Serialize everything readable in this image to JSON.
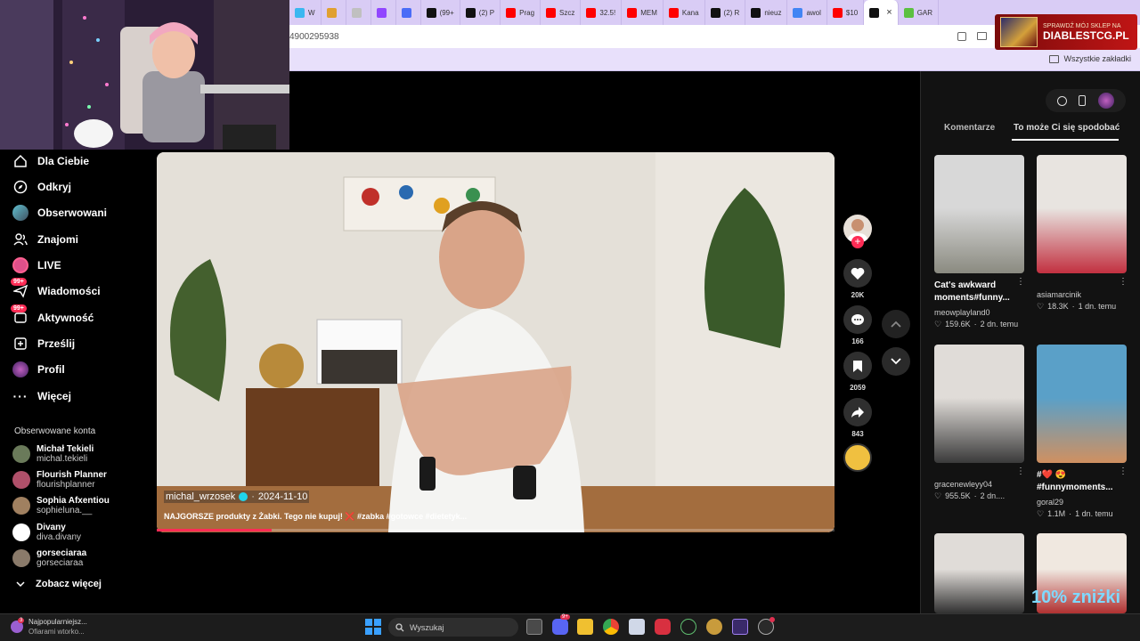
{
  "browser": {
    "tabs": [
      {
        "label": "W",
        "color": "#3ab7f0"
      },
      {
        "label": "",
        "color": "#e0a030"
      },
      {
        "label": "",
        "color": "#c0c0c0"
      },
      {
        "label": "",
        "color": "#9146ff"
      },
      {
        "label": "",
        "color": "#4a6cf7"
      },
      {
        "label": "(99+",
        "color": "#111111"
      },
      {
        "label": "(2) P",
        "color": "#111111"
      },
      {
        "label": "Prag",
        "color": "#ff0000"
      },
      {
        "label": "Szcz",
        "color": "#ff0000"
      },
      {
        "label": "32.5!",
        "color": "#ff0000"
      },
      {
        "label": "MEM",
        "color": "#ff0000"
      },
      {
        "label": "Kana",
        "color": "#ff0000"
      },
      {
        "label": "(2) R",
        "color": "#111111"
      },
      {
        "label": "nieuz",
        "color": "#111111"
      },
      {
        "label": "awol",
        "color": "#4285f4"
      },
      {
        "label": "$10",
        "color": "#ff0000"
      },
      {
        "label": "",
        "color": "#111111"
      },
      {
        "label": "GAR",
        "color": "#5cc040"
      }
    ],
    "address": "4900295938",
    "bookmarks_all": "Wszystkie zakładki"
  },
  "ad": {
    "line1": "SPRAWDŹ MÓJ SKLEP NA",
    "line2": "DIABLESTCG.PL"
  },
  "sidebar": {
    "items": [
      {
        "label": "Dla Ciebie",
        "icon": "home-icon"
      },
      {
        "label": "Odkryj",
        "icon": "compass-icon"
      },
      {
        "label": "Obserwowani",
        "icon": "following-icon"
      },
      {
        "label": "Znajomi",
        "icon": "friends-icon"
      },
      {
        "label": "LIVE",
        "icon": "live-icon"
      },
      {
        "label": "Wiadomości",
        "icon": "messages-icon",
        "badge": "99+"
      },
      {
        "label": "Aktywność",
        "icon": "activity-icon",
        "badge": "99+"
      },
      {
        "label": "Prześlij",
        "icon": "upload-icon"
      },
      {
        "label": "Profil",
        "icon": "profile-icon"
      },
      {
        "label": "Więcej",
        "icon": "more-icon"
      }
    ],
    "following_title": "Obserwowane konta",
    "accounts": [
      {
        "name": "Michał Tekieli",
        "handle": "michal.tekieli",
        "color": "#6a7a5a"
      },
      {
        "name": "Flourish Planner",
        "handle": "flourishplanner",
        "color": "#b0506a"
      },
      {
        "name": "Sophia Afxentiou",
        "handle": "sophieluna.__",
        "color": "#a08060"
      },
      {
        "name": "Divany",
        "handle": "diva.divany",
        "color": "#ffffff"
      },
      {
        "name": "gorseciaraa",
        "handle": "gorseciaraa",
        "color": "#8a7a6a"
      }
    ],
    "see_more": "Zobacz więcej"
  },
  "video": {
    "username": "michal_wrzosek",
    "date": "2024-11-10",
    "caption": "NAJGORSZE produkty z Żabki. Tego nie kupuj! ❌ #zabka #gotowce #dietetyk...",
    "progress_pct": 17
  },
  "actions": {
    "likes": "20K",
    "comments": "166",
    "saves": "2059",
    "shares": "843"
  },
  "right": {
    "tab_comments": "Komentarze",
    "tab_like": "To może Ci się spodobać",
    "cards": [
      {
        "title": "Cat's awkward moments#funny...",
        "user": "meowplayland0",
        "likes": "159.6K",
        "age": "2 dn. temu",
        "colors": [
          "#d8d8d8",
          "#8a8a80"
        ]
      },
      {
        "title": "",
        "user": "asiamarcinik",
        "likes": "18.3K",
        "age": "1 dn. temu",
        "colors": [
          "#e8e4e0",
          "#c23040"
        ]
      },
      {
        "title": "",
        "user": "gracenewleyy04",
        "likes": "955.5K",
        "age": "2 dn....",
        "colors": [
          "#e0dcd8",
          "#3a3a3a"
        ]
      },
      {
        "title": "#❤️ 😍 #funnymoments...",
        "user": "goral29",
        "likes": "1.1M",
        "age": "1 dn. temu",
        "colors": [
          "#5aa0c8",
          "#d09060"
        ]
      },
      {
        "title": "",
        "user": "",
        "likes": "",
        "age": "",
        "colors": [
          "#e0dcd8",
          "#303030"
        ]
      },
      {
        "title": "",
        "user": "",
        "likes": "",
        "age": "",
        "colors": [
          "#f0e8e0",
          "#b03030"
        ]
      }
    ]
  },
  "promo": "10% zniżki",
  "taskbar": {
    "news_title": "Najpopularniejsz...",
    "news_sub": "Ofiarami wtorko...",
    "news_badge": "3",
    "search": "Wyszukaj",
    "discord_badge": "9+"
  }
}
